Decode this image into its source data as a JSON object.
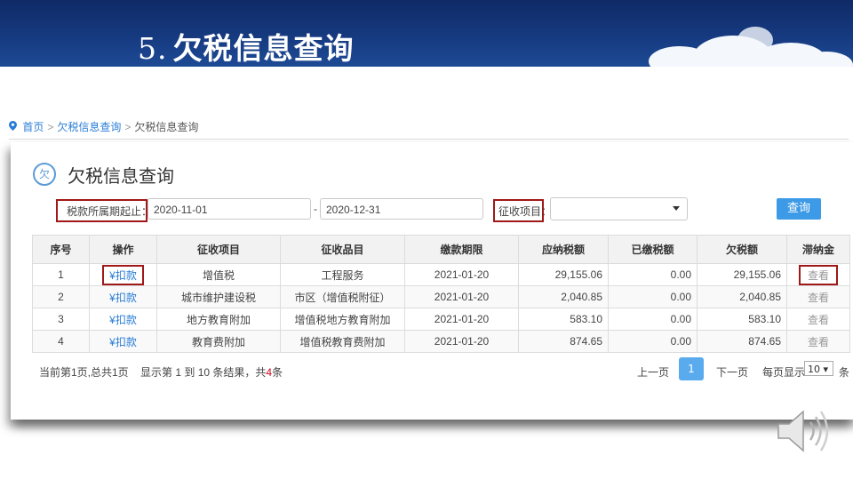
{
  "slide": {
    "number": "5.",
    "title": "欠税信息查询"
  },
  "breadcrumb": {
    "home": "首页",
    "sep": ">",
    "level1": "欠税信息查询",
    "level2": "欠税信息查询"
  },
  "panel": {
    "title": "欠税信息查询",
    "title_icon_char": "欠",
    "filter": {
      "period_label": "税款所属期起止：",
      "start_date": "2020-11-01",
      "range_sep": "-",
      "end_date": "2020-12-31",
      "item_label": "征收项目：",
      "item_value": "",
      "query_button": "查询"
    },
    "table": {
      "headers": [
        "序号",
        "操作",
        "征收项目",
        "征收品目",
        "缴款期限",
        "应纳税额",
        "已缴税额",
        "欠税额",
        "滞纳金"
      ],
      "rows": [
        {
          "no": "1",
          "op": "¥扣款",
          "item": "增值税",
          "sub": "工程服务",
          "deadline": "2021-01-20",
          "due": "29,155.06",
          "paid": "0.00",
          "owed": "29,155.06",
          "late": "查看"
        },
        {
          "no": "2",
          "op": "¥扣款",
          "item": "城市维护建设税",
          "sub": "市区（增值税附征）",
          "deadline": "2021-01-20",
          "due": "2,040.85",
          "paid": "0.00",
          "owed": "2,040.85",
          "late": "查看"
        },
        {
          "no": "3",
          "op": "¥扣款",
          "item": "地方教育附加",
          "sub": "增值税地方教育附加",
          "deadline": "2021-01-20",
          "due": "583.10",
          "paid": "0.00",
          "owed": "583.10",
          "late": "查看"
        },
        {
          "no": "4",
          "op": "¥扣款",
          "item": "教育费附加",
          "sub": "增值税教育费附加",
          "deadline": "2021-01-20",
          "due": "874.65",
          "paid": "0.00",
          "owed": "874.65",
          "late": "查看"
        }
      ]
    },
    "pager": {
      "page_info": "当前第1页,总共1页",
      "result_prefix": "显示第 1 到 10 条结果，共",
      "total": "4",
      "result_suffix": "条",
      "prev": "上一页",
      "current": "1",
      "next": "下一页",
      "per_page_label": "每页显示",
      "per_page_value": "10 ▾",
      "per_page_unit": "条"
    }
  },
  "colors": {
    "accent": "#2a7dd6",
    "highlight_border": "#a01818",
    "banner": "#163a80"
  }
}
